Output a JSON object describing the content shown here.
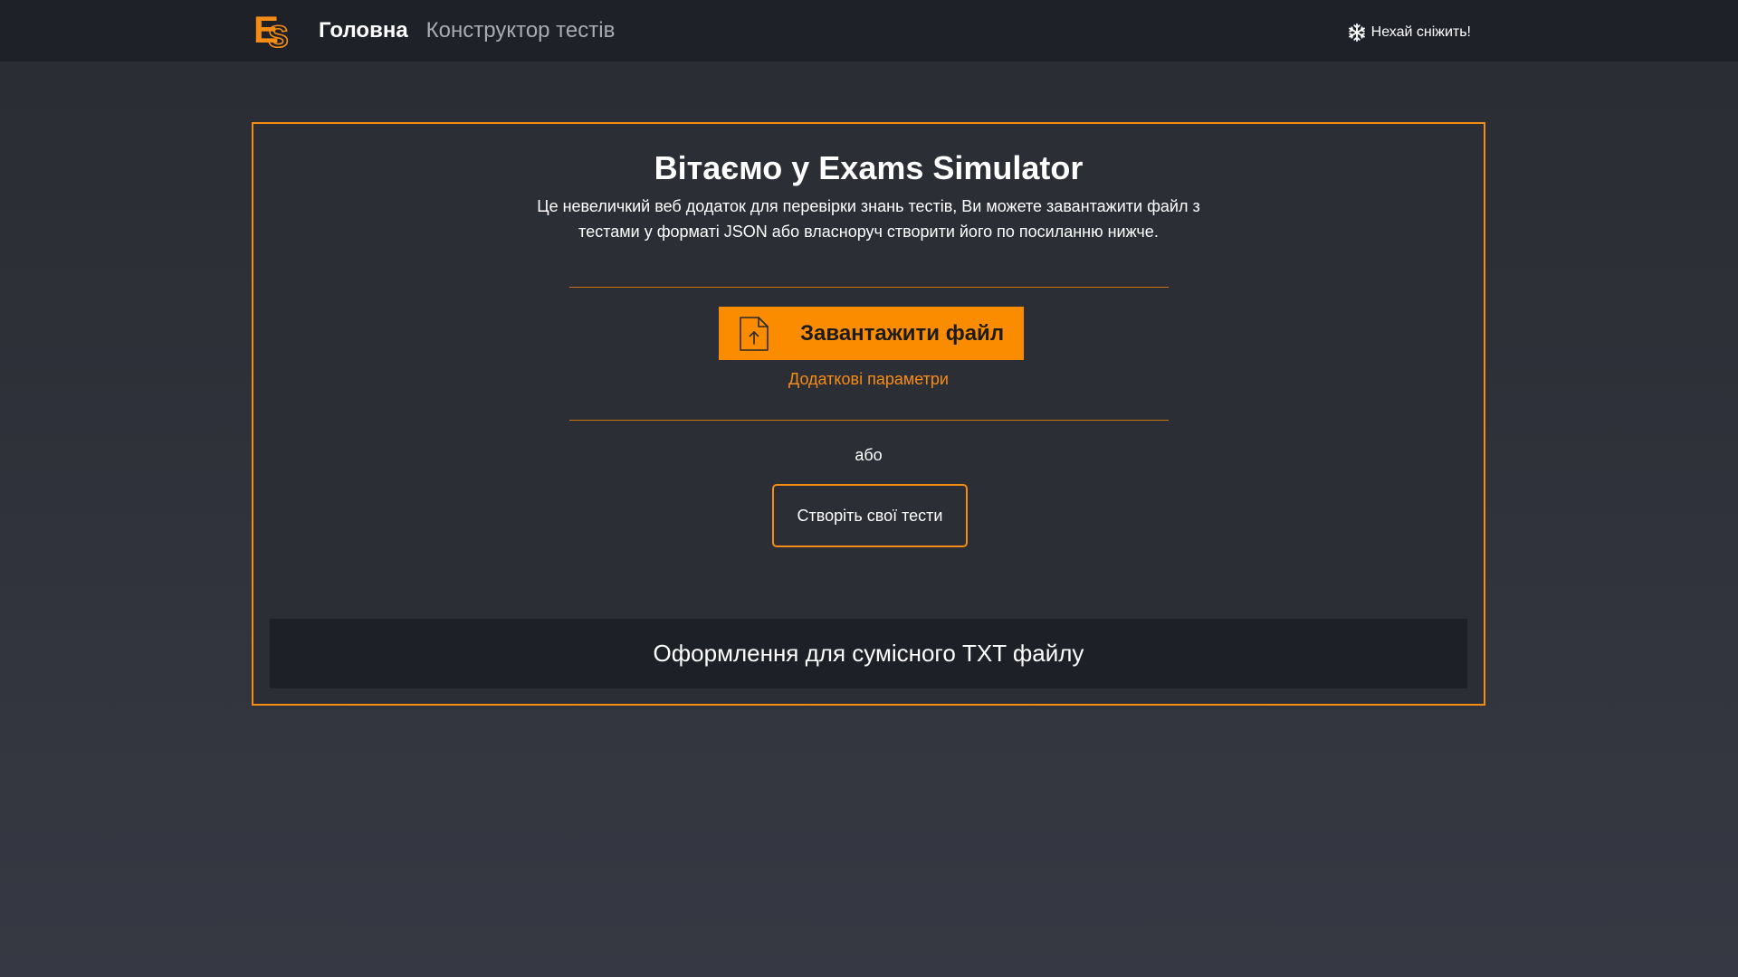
{
  "colors": {
    "accent": "#f78c14",
    "navbar_bg": "#1f2129",
    "page_bg": "#30323b",
    "card_bg": "#2c2e36",
    "panel_bg": "#1e2028"
  },
  "navbar": {
    "logo": {
      "letter_e": "E",
      "letter_s": "S"
    },
    "links": [
      {
        "label": "Головна",
        "active": true
      },
      {
        "label": "Конструктор тестів",
        "active": false
      }
    ],
    "snow_toggle": {
      "icon": "snowflake-icon",
      "label": "Нехай сніжить!"
    }
  },
  "main": {
    "title": "Вітаємо у Exams Simulator",
    "intro": "Це невеличкий веб додаток для перевірки знань тестів, Ви можете завантажити файл з тестами у форматі JSON або власноруч створити його по посиланню нижче.",
    "upload_button": {
      "icon": "file-upload-icon",
      "label": "Завантажити файл"
    },
    "extra_params_link": "Додаткові параметри",
    "or_text": "або",
    "create_button": "Створіть свої тести",
    "txt_format_panel": "Оформлення для сумісного TXT файлу"
  }
}
